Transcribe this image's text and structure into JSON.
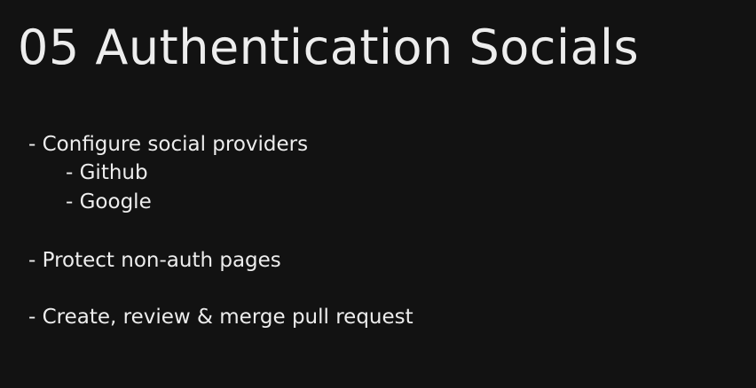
{
  "slide": {
    "title": "05 Authentication Socials",
    "bullets": {
      "configure": "- Configure social providers",
      "github": "- Github",
      "google": "- Google",
      "protect": "- Protect non-auth pages",
      "pr": "- Create, review & merge pull request"
    }
  },
  "colors": {
    "background": "#121212",
    "text": "#ededed"
  }
}
